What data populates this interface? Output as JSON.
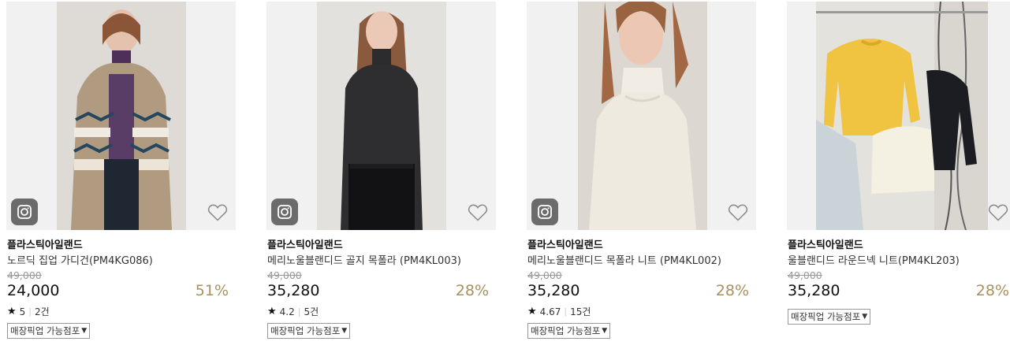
{
  "products": [
    {
      "brand": "플라스틱아일랜드",
      "name": "노르딕 집업 가디건(PM4KG086)",
      "original_price": "49,000",
      "price": "24,000",
      "discount": "51%",
      "rating": "5",
      "reviews": "2건",
      "pickup_label": "매장픽업 가능점포",
      "has_story_icon": true
    },
    {
      "brand": "플라스틱아일랜드",
      "name": "메리노울블랜디드 골지 목폴라 (PM4KL003)",
      "original_price": "49,000",
      "price": "35,280",
      "discount": "28%",
      "rating": "4.2",
      "reviews": "5건",
      "pickup_label": "매장픽업 가능점포",
      "has_story_icon": true
    },
    {
      "brand": "플라스틱아일랜드",
      "name": "메리노울블랜디드 목폴라 니트 (PM4KL002)",
      "original_price": "49,000",
      "price": "35,280",
      "discount": "28%",
      "rating": "4.67",
      "reviews": "15건",
      "pickup_label": "매장픽업 가능점포",
      "has_story_icon": true
    },
    {
      "brand": "플라스틱아일랜드",
      "name": "울블랜디드 라운드넥 니트(PM4KL203)",
      "original_price": "49,000",
      "price": "35,280",
      "discount": "28%",
      "rating": null,
      "reviews": null,
      "pickup_label": "매장픽업 가능점포",
      "has_story_icon": false
    }
  ],
  "icons": {
    "story": "camera-icon",
    "wishlist": "heart-outline-icon",
    "rating": "star-icon",
    "dropdown": "caret-down-icon"
  },
  "colors": {
    "discount": "#a8915e",
    "thumb_bg": "#f1f1f1",
    "story_icon_bg": "#6b6b6b"
  }
}
